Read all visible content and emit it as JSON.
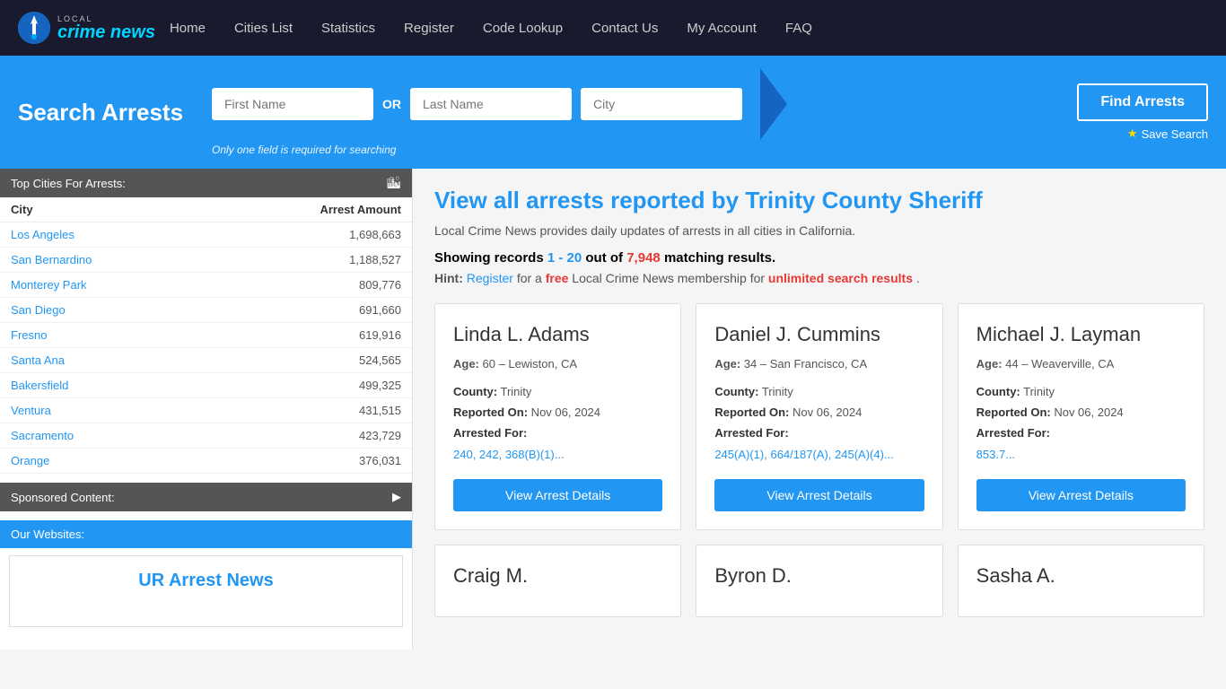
{
  "nav": {
    "logo_text": "crime news",
    "logo_subtext": "LOCAL",
    "links": [
      {
        "label": "Home",
        "name": "nav-home"
      },
      {
        "label": "Cities List",
        "name": "nav-cities-list"
      },
      {
        "label": "Statistics",
        "name": "nav-statistics"
      },
      {
        "label": "Register",
        "name": "nav-register"
      },
      {
        "label": "Code Lookup",
        "name": "nav-code-lookup"
      },
      {
        "label": "Contact Us",
        "name": "nav-contact-us"
      },
      {
        "label": "My Account",
        "name": "nav-my-account"
      },
      {
        "label": "FAQ",
        "name": "nav-faq"
      }
    ]
  },
  "search": {
    "title": "Search Arrests",
    "first_name_placeholder": "First Name",
    "last_name_placeholder": "Last Name",
    "city_placeholder": "City",
    "or_label": "OR",
    "hint": "Only one field is required for searching",
    "find_arrests_label": "Find Arrests",
    "save_search_label": "Save Search"
  },
  "sidebar": {
    "top_cities_header": "Top Cities For Arrests:",
    "columns": {
      "city": "City",
      "arrest_amount": "Arrest Amount"
    },
    "cities": [
      {
        "name": "Los Angeles",
        "amount": "1,698,663"
      },
      {
        "name": "San Bernardino",
        "amount": "1,188,527"
      },
      {
        "name": "Monterey Park",
        "amount": "809,776"
      },
      {
        "name": "San Diego",
        "amount": "691,660"
      },
      {
        "name": "Fresno",
        "amount": "619,916"
      },
      {
        "name": "Santa Ana",
        "amount": "524,565"
      },
      {
        "name": "Bakersfield",
        "amount": "499,325"
      },
      {
        "name": "Ventura",
        "amount": "431,515"
      },
      {
        "name": "Sacramento",
        "amount": "423,729"
      },
      {
        "name": "Orange",
        "amount": "376,031"
      }
    ],
    "sponsored_header": "Sponsored Content:",
    "websites_header": "Our Websites:",
    "ur_arrest_news": "UR Arrest News"
  },
  "main": {
    "page_title": "View all arrests reported by Trinity County Sheriff",
    "subtitle": "Local Crime News provides daily updates of arrests in all cities in California.",
    "results_label": "Showing records",
    "results_range": "1 - 20",
    "results_out_of": "out of",
    "results_total": "7,948",
    "results_suffix": "matching results.",
    "hint_prefix": "Hint:",
    "hint_register": "Register",
    "hint_middle": "for a",
    "hint_free": "free",
    "hint_middle2": "Local Crime News membership for",
    "hint_unlimited": "unlimited search results",
    "hint_end": ".",
    "cards_row1": [
      {
        "name": "Linda L. Adams",
        "age": "60",
        "location": "Lewiston, CA",
        "county": "Trinity",
        "reported_on": "Nov 06, 2024",
        "arrested_for_label": "Arrested For:",
        "codes": "240, 242, 368(B)(1)..."
      },
      {
        "name": "Daniel J. Cummins",
        "age": "34",
        "location": "San Francisco, CA",
        "county": "Trinity",
        "reported_on": "Nov 06, 2024",
        "arrested_for_label": "Arrested For:",
        "codes": "245(A)(1), 664/187(A), 245(A)(4)..."
      },
      {
        "name": "Michael J. Layman",
        "age": "44",
        "location": "Weaverville, CA",
        "county": "Trinity",
        "reported_on": "Nov 06, 2024",
        "arrested_for_label": "Arrested For:",
        "codes": "853.7..."
      }
    ],
    "cards_row2": [
      {
        "name": "Craig M."
      },
      {
        "name": "Byron D."
      },
      {
        "name": "Sasha A."
      }
    ],
    "view_details_label": "View Arrest Details",
    "age_label": "Age:",
    "county_label": "County:",
    "reported_label": "Reported On:"
  }
}
